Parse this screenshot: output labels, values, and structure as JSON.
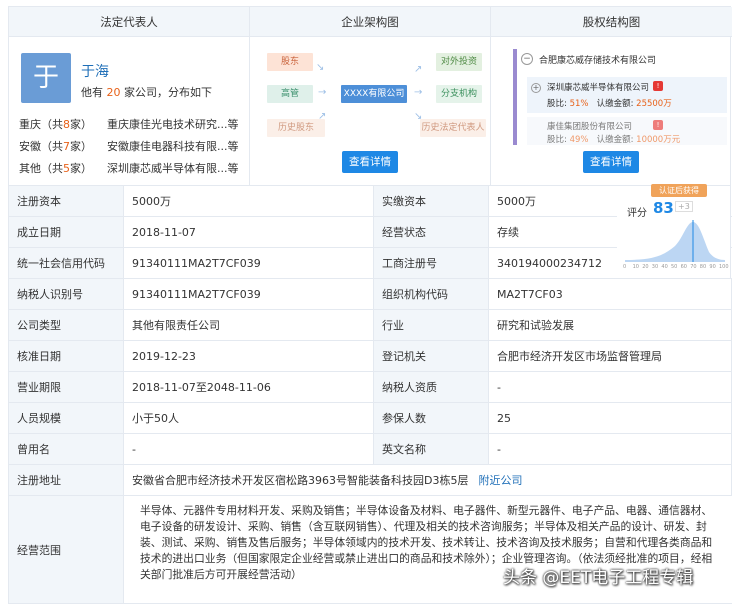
{
  "top": {
    "rep_header": "法定代表人",
    "org_header": "企业架构图",
    "equity_header": "股权结构图",
    "avatar_char": "于",
    "rep_name": "于海",
    "rep_summary_pre": "他有",
    "rep_summary_num": "20",
    "rep_summary_post": "家公司，分布如下",
    "regions": [
      {
        "name": "重庆（共",
        "count": "8",
        "unit": "家）",
        "company": "重庆康佳光电技术研究...等"
      },
      {
        "name": "安徽（共",
        "count": "7",
        "unit": "家）",
        "company": "安徽康佳电器科技有限...等"
      },
      {
        "name": "其他（共",
        "count": "5",
        "unit": "家）",
        "company": "深圳康芯威半导体有限...等"
      }
    ],
    "org": {
      "shareholder": "股东",
      "manager": "高管",
      "history_shareholder": "历史股东",
      "center": "XXXX有限公司",
      "investment": "对外投资",
      "branch": "分支机构",
      "history_rep": "历史法定代表人",
      "button": "查看详情"
    },
    "equity": {
      "root": "合肥康芯威存储技术有限公司",
      "sh1_name": "深圳康芯威半导体有限公司",
      "sh1_ratio_label": "股比:",
      "sh1_ratio": "51%",
      "sh1_amount_label": "认缴金额:",
      "sh1_amount": "25500万",
      "sh2_name": "康佳集团股份有限公司",
      "sh2_ratio_label": "股比:",
      "sh2_ratio": "49%",
      "sh2_amount_label": "认缴金额:",
      "sh2_amount": "10000万元",
      "button": "查看详情"
    }
  },
  "score": {
    "badge": "认证后获得",
    "label": "评分",
    "value": "83",
    "delta": "+3",
    "ticks": [
      "0",
      "10",
      "20",
      "30",
      "40",
      "50",
      "60",
      "70",
      "80",
      "90",
      "100"
    ]
  },
  "rows": [
    {
      "l1": "注册资本",
      "v1": "5000万",
      "l2": "实缴资本",
      "v2": "5000万"
    },
    {
      "l1": "成立日期",
      "v1": "2018-11-07",
      "l2": "经营状态",
      "v2": "存续"
    },
    {
      "l1": "统一社会信用代码",
      "v1": "91340111MA2T7CF039",
      "l2": "工商注册号",
      "v2": "340194000234712"
    },
    {
      "l1": "纳税人识别号",
      "v1": "91340111MA2T7CF039",
      "l2": "组织机构代码",
      "v2": "MA2T7CF03"
    },
    {
      "l1": "公司类型",
      "v1": "其他有限责任公司",
      "l2": "行业",
      "v2": "研究和试验发展"
    },
    {
      "l1": "核准日期",
      "v1": "2019-12-23",
      "l2": "登记机关",
      "v2": "合肥市经济开发区市场监督管理局"
    },
    {
      "l1": "营业期限",
      "v1": "2018-11-07至2048-11-06",
      "l2": "纳税人资质",
      "v2": "-"
    },
    {
      "l1": "人员规模",
      "v1": "小于50人",
      "l2": "参保人数",
      "v2": "25"
    },
    {
      "l1": "曾用名",
      "v1": "-",
      "l2": "英文名称",
      "v2": "-"
    }
  ],
  "address": {
    "label": "注册地址",
    "value": "安徽省合肥市经济技术开发区宿松路3963号智能装备科技园D3栋5层",
    "link": "附近公司"
  },
  "scope": {
    "label": "经营范围",
    "value": "半导体、元器件专用材料开发、采购及销售；半导体设备及材料、电子器件、新型元器件、电子产品、电器、通信器材、电子设备的研发设计、采购、销售（含互联网销售）、代理及相关的技术咨询服务；半导体及相关产品的设计、研发、封装、测试、采购、销售及售后服务；半导体领域内的技术开发、技术转让、技术咨询及技术服务；自营和代理各类商品和技术的进出口业务（但国家限定企业经营或禁止进出口的商品和技术除外）；企业管理咨询。（依法须经批准的项目，经相关部门批准后方可开展经营活动）"
  },
  "watermark": "头条 @EET电子工程专辑",
  "colors": {
    "accent": "#1e88e5",
    "link": "#1f6fb8",
    "highlight": "#e8621a",
    "label_bg": "#f2f6fa"
  }
}
